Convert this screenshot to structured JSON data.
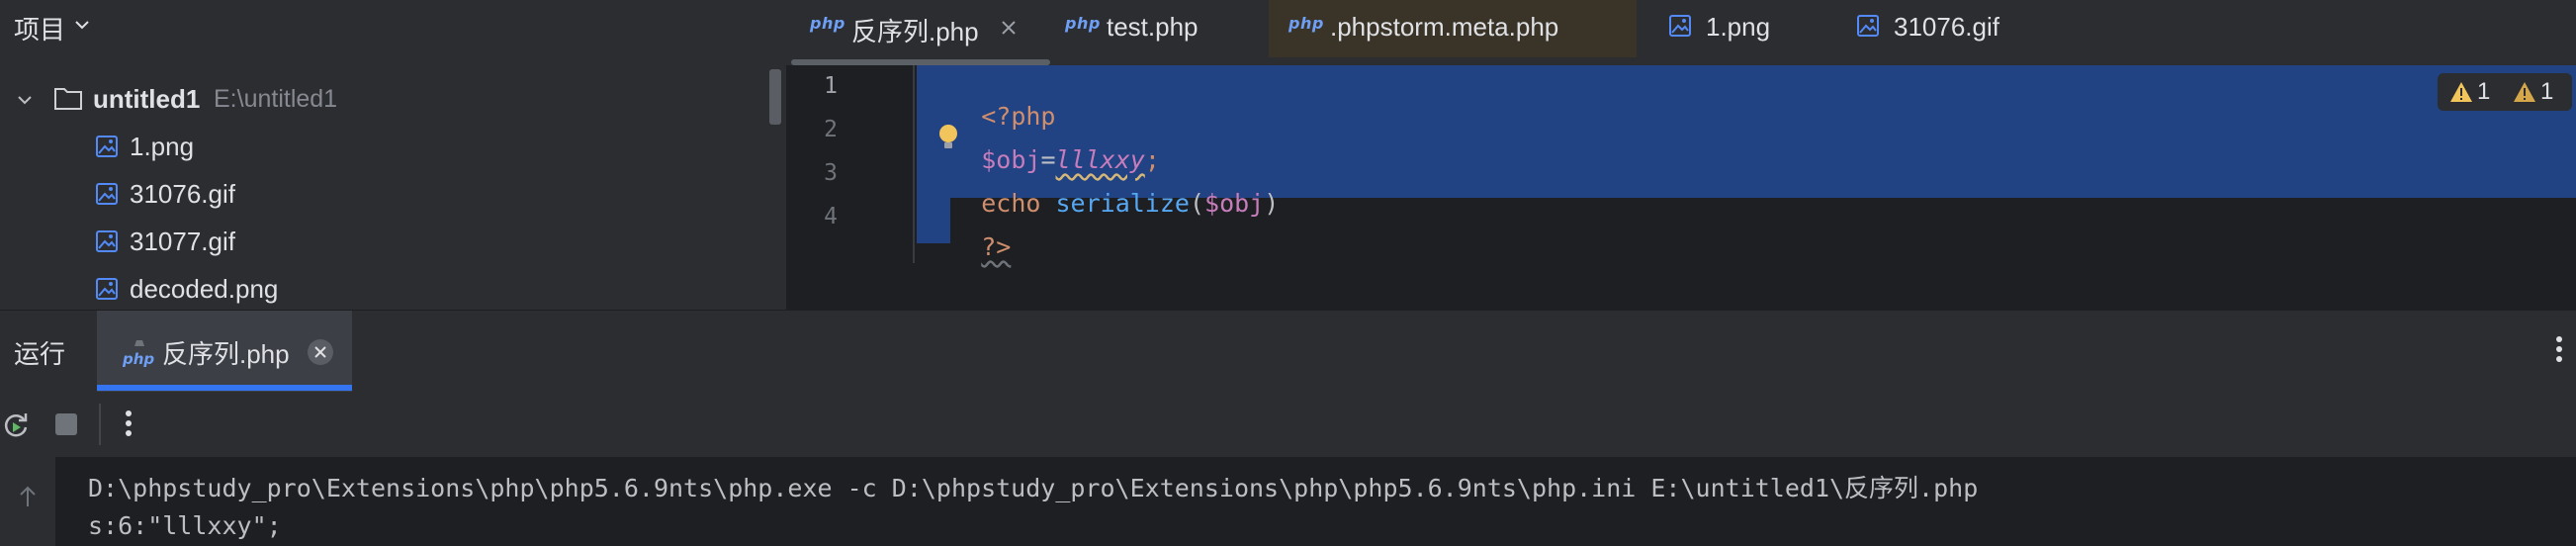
{
  "project_panel": {
    "title": "项目",
    "root": {
      "name": "untitled1",
      "path": "E:\\untitled1"
    },
    "files": [
      "1.png",
      "31076.gif",
      "31077.gif",
      "decoded.png"
    ]
  },
  "editor_tabs": [
    {
      "icon": "php",
      "label": "反序列.php",
      "active": true
    },
    {
      "icon": "php",
      "label": "test.php"
    },
    {
      "icon": "php",
      "label": ".phpstorm.meta.php"
    },
    {
      "icon": "image",
      "label": "1.png"
    },
    {
      "icon": "image",
      "label": "31076.gif"
    }
  ],
  "editor": {
    "line_numbers": [
      "1",
      "2",
      "3",
      "4"
    ],
    "code": {
      "l1": "<?php",
      "l2_var_a": "$",
      "l2_var_b": "obj",
      "l2_eq": "=",
      "l2_const": "lllxxy",
      "l2_semi": ";",
      "l3_echo": "echo ",
      "l3_fn": "serialize",
      "l3_open": "(",
      "l3_var": "$obj",
      "l3_close": ")",
      "l4": "?>"
    },
    "inspections": {
      "warnings_a": "1",
      "warnings_b": "1"
    }
  },
  "run_window": {
    "title": "运行",
    "tab_label": "反序列.php",
    "console_lines": [
      "D:\\phpstudy_pro\\Extensions\\php\\php5.6.9nts\\php.exe -c D:\\phpstudy_pro\\Extensions\\php\\php5.6.9nts\\php.ini E:\\untitled1\\反序列.php",
      "s:6:\"lllxxy\";"
    ]
  },
  "icons": {
    "php_mark": "php",
    "project_chevron": "chevron-down-icon",
    "folder": "folder-icon",
    "image_file": "image-file-icon",
    "bulb": "lightbulb-icon",
    "warning": "warning-icon",
    "rerun": "rerun-icon",
    "stop": "stop-icon",
    "more": "more-vertical-icon"
  },
  "colors": {
    "selection": "#214283",
    "keyword": "#cf8e6d",
    "variable": "#c77dbb",
    "function": "#56a8f5",
    "accent": "#3574f0"
  }
}
